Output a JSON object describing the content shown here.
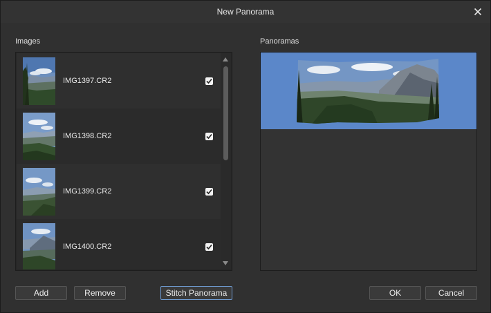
{
  "window": {
    "title": "New Panorama",
    "close_icon": "close-icon"
  },
  "images": {
    "label": "Images",
    "items": [
      {
        "filename": "IMG1397.CR2",
        "checked": true
      },
      {
        "filename": "IMG1398.CR2",
        "checked": true
      },
      {
        "filename": "IMG1399.CR2",
        "checked": true
      },
      {
        "filename": "IMG1400.CR2",
        "checked": true
      }
    ]
  },
  "panoramas": {
    "label": "Panoramas"
  },
  "buttons": {
    "add": "Add",
    "remove": "Remove",
    "stitch": "Stitch Panorama",
    "ok": "OK",
    "cancel": "Cancel"
  },
  "colors": {
    "dialog_bg": "#303030",
    "list_bg": "#262626",
    "panorama_bg": "#5b87c9",
    "accent_border": "#6f9bd1",
    "text": "#e6e6e6"
  }
}
